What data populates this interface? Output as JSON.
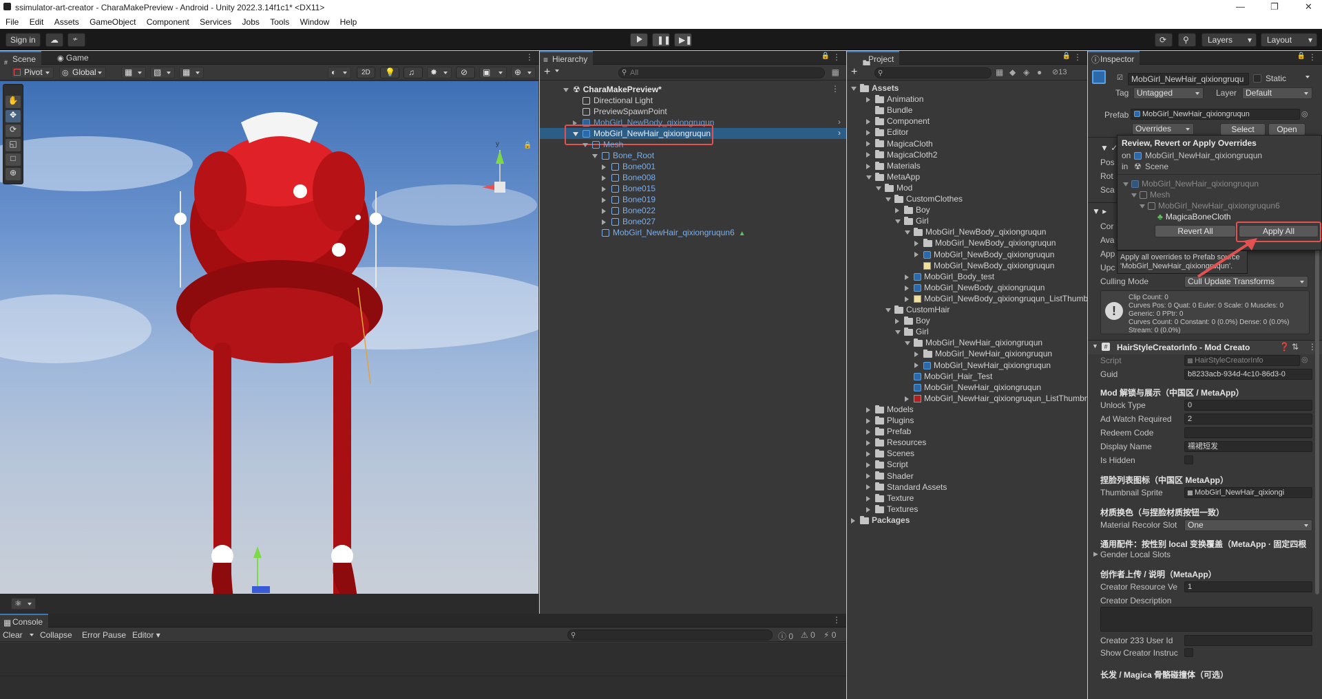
{
  "window": {
    "title": "ssimulator-art-creator - CharaMakePreview - Android - Unity 2022.3.14f1c1* <DX11>"
  },
  "menu": [
    "File",
    "Edit",
    "Assets",
    "GameObject",
    "Component",
    "Services",
    "Jobs",
    "Tools",
    "Window",
    "Help"
  ],
  "toolbar": {
    "sign_in": "Sign in",
    "layers": "Layers",
    "layout": "Layout"
  },
  "scene": {
    "tab_scene": "Scene",
    "tab_game": "Game",
    "pivot": "Pivot",
    "global": "Global",
    "twod": "2D",
    "gizmo_y": "y"
  },
  "console": {
    "tab": "Console",
    "clear": "Clear",
    "collapse": "Collapse",
    "error_pause": "Error Pause",
    "editor": "Editor",
    "count_log": "0",
    "count_warn": "0",
    "count_err": "0"
  },
  "hierarchy": {
    "tab": "Hierarchy",
    "search_placeholder": "All",
    "scene": "CharaMakePreview*",
    "items": [
      {
        "label": "Directional Light"
      },
      {
        "label": "PreviewSpawnPoint"
      },
      {
        "label": "MobGirl_NewBody_qixiongruqun"
      },
      {
        "label": "MobGirl_NewHair_qixiongruqun"
      },
      {
        "label": "Mesh"
      },
      {
        "label": "Bone_Root"
      },
      {
        "label": "Bone001"
      },
      {
        "label": "Bone008"
      },
      {
        "label": "Bone015"
      },
      {
        "label": "Bone019"
      },
      {
        "label": "Bone022"
      },
      {
        "label": "Bone027"
      },
      {
        "label": "MobGirl_NewHair_qixiongruqun6"
      }
    ]
  },
  "project": {
    "tab": "Project",
    "count": "13",
    "items": [
      {
        "label": "Assets"
      },
      {
        "label": "Animation"
      },
      {
        "label": "Bundle"
      },
      {
        "label": "Component"
      },
      {
        "label": "Editor"
      },
      {
        "label": "MagicaCloth"
      },
      {
        "label": "MagicaCloth2"
      },
      {
        "label": "Materials"
      },
      {
        "label": "MetaApp"
      },
      {
        "label": "Mod"
      },
      {
        "label": "CustomClothes"
      },
      {
        "label": "Boy"
      },
      {
        "label": "Girl"
      },
      {
        "label": "MobGirl_NewBody_qixiongruqun"
      },
      {
        "label": "MobGirl_NewBody_qixiongruqun"
      },
      {
        "label": "MobGirl_NewBody_qixiongruqun"
      },
      {
        "label": "MobGirl_NewBody_qixiongruqun"
      },
      {
        "label": "MobGirl_Body_test"
      },
      {
        "label": "MobGirl_NewBody_qixiongruqun"
      },
      {
        "label": "MobGirl_NewBody_qixiongruqun_ListThumb"
      },
      {
        "label": "CustomHair"
      },
      {
        "label": "Boy"
      },
      {
        "label": "Girl"
      },
      {
        "label": "MobGirl_NewHair_qixiongruqun"
      },
      {
        "label": "MobGirl_NewHair_qixiongruqun"
      },
      {
        "label": "MobGirl_NewHair_qixiongruqun"
      },
      {
        "label": "MobGirl_Hair_Test"
      },
      {
        "label": "MobGirl_NewHair_qixiongruqun"
      },
      {
        "label": "MobGirl_NewHair_qixiongruqun_ListThumbn"
      },
      {
        "label": "Models"
      },
      {
        "label": "Plugins"
      },
      {
        "label": "Prefab"
      },
      {
        "label": "Resources"
      },
      {
        "label": "Scenes"
      },
      {
        "label": "Script"
      },
      {
        "label": "Shader"
      },
      {
        "label": "Standard Assets"
      },
      {
        "label": "Texture"
      },
      {
        "label": "Textures"
      },
      {
        "label": "Packages"
      }
    ]
  },
  "inspector": {
    "tab": "Inspector",
    "object_name": "MobGirl_NewHair_qixiongruqu",
    "static": "Static",
    "tag_label": "Tag",
    "tag_value": "Untagged",
    "layer_label": "Layer",
    "layer_value": "Default",
    "prefab_label": "Prefab",
    "prefab_value": "MobGirl_NewHair_qixiongruqun",
    "overrides": "Overrides",
    "select": "Select",
    "open": "Open",
    "pos": "Pos",
    "rot": "Rot",
    "sca": "Sca",
    "con": "Cor",
    "ava": "Ava",
    "app": "App",
    "upd": "Upc",
    "culling_label": "Culling Mode",
    "culling_value": "Cull Update Transforms",
    "info_lines": [
      "Clip Count: 0",
      "Curves Pos: 0 Quat: 0 Euler: 0 Scale: 0 Muscles: 0",
      "Generic: 0 PPtr: 0",
      "Curves Count: 0 Constant: 0 (0.0%) Dense: 0 (0.0%)",
      "Stream: 0 (0.0%)"
    ],
    "component": "HairStyleCreatorInfo - Mod Creato",
    "script_label": "Script",
    "script_value": "HairStyleCreatorInfo",
    "guid_label": "Guid",
    "guid_value": "b8233acb-934d-4c10-86d3-0",
    "sec1": "Mod 解锁与展示（中国区 / MetaApp）",
    "unlock_label": "Unlock Type",
    "unlock_value": "0",
    "ad_label": "Ad Watch Required",
    "ad_value": "2",
    "redeem_label": "Redeem Code",
    "redeem_value": "",
    "display_label": "Display Name",
    "display_value": "襦裙短发",
    "hidden_label": "Is Hidden",
    "sec2": "捏脸列表图标（中国区 MetaApp）",
    "thumb_label": "Thumbnail Sprite",
    "thumb_value": "MobGirl_NewHair_qixiongi",
    "sec3": "材质换色（与捏脸材质按钮一致）",
    "recolor_label": "Material Recolor Slot",
    "recolor_value": "One",
    "sec4": "通用配件：按性别 local 变换覆盖（MetaApp · 固定四根",
    "gender_label": "Gender Local Slots",
    "sec5": "创作者上传 / 说明（MetaApp）",
    "creator_res_label": "Creator Resource Ve",
    "creator_res_value": "1",
    "creator_desc_label": "Creator Description",
    "creator_233_label": "Creator 233 User Id",
    "show_creator_label": "Show Creator Instruc",
    "sec6": "长发 / Magica 骨骼碰撞体（可选）"
  },
  "popup": {
    "title": "Review, Revert or Apply Overrides",
    "on_label": "on",
    "on_value": "MobGirl_NewHair_qixiongruqun",
    "in_label": "in",
    "in_value": "Scene",
    "tree": [
      "MobGirl_NewHair_qixiongruqun",
      "Mesh",
      "MobGirl_NewHair_qixiongruqun6",
      "MagicaBoneCloth"
    ],
    "revert_all": "Revert All",
    "apply_all": "Apply All",
    "tooltip_l1": "Apply all overrides to Prefab source",
    "tooltip_l2": "'MobGirl_NewHair_qixiongruqun'."
  },
  "colors": {
    "accent_red": "#e35151",
    "selection": "#2c5d87",
    "link_blue": "#7ab0ee"
  }
}
